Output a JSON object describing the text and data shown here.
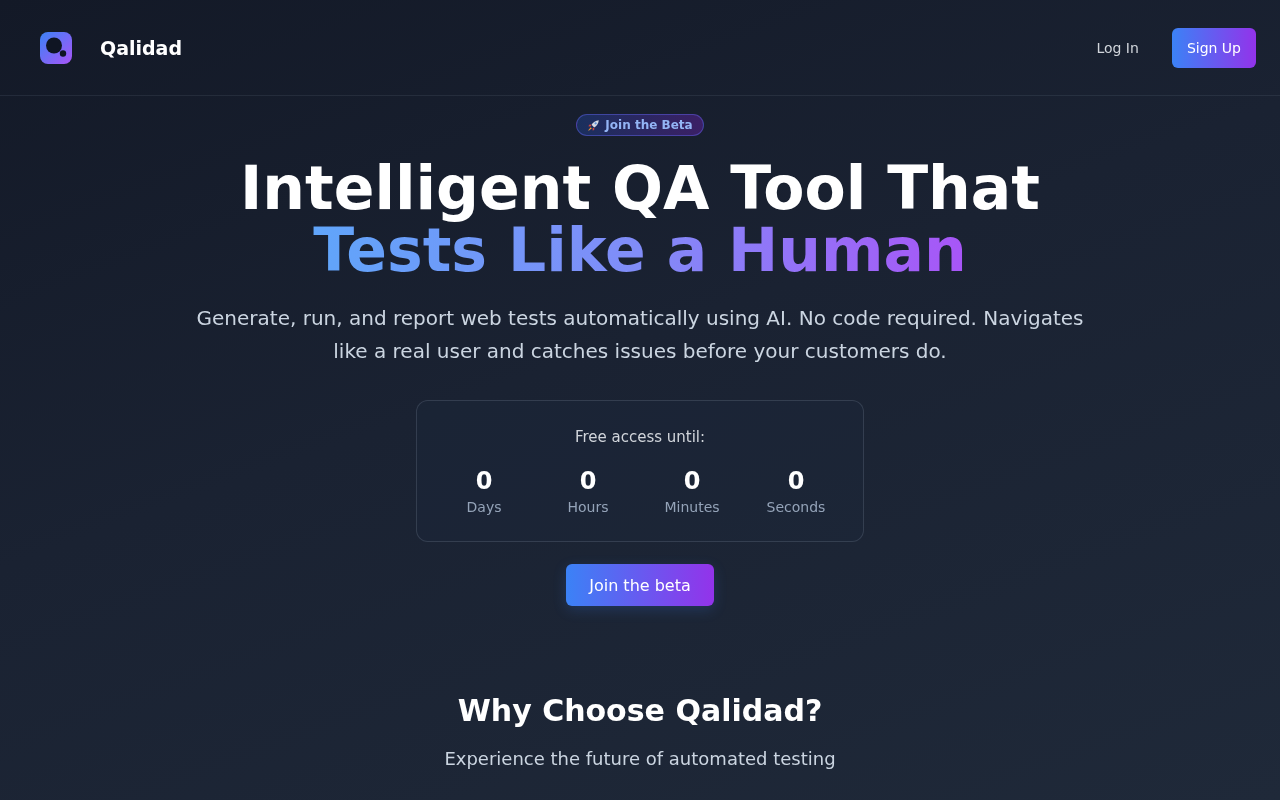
{
  "nav": {
    "brand": "Qalidad",
    "actions": [
      {
        "label": "Log In",
        "kind": "link"
      },
      {
        "label": "Sign Up",
        "kind": "primary"
      }
    ]
  },
  "hero": {
    "badge": "Join the Beta",
    "title": "Intelligent QA Tool That",
    "title_highlight": "Tests Like a Human",
    "description": "Generate, run, and report web tests automatically using AI. No code required. Navigates like a real user and catches issues before your customers do.",
    "countdown": {
      "label": "Free access until:",
      "units": [
        {
          "value": "0",
          "label": "Days"
        },
        {
          "value": "0",
          "label": "Hours"
        },
        {
          "value": "0",
          "label": "Minutes"
        },
        {
          "value": "0",
          "label": "Seconds"
        }
      ]
    },
    "cta": "Join the beta"
  },
  "features": {
    "title": "Why Choose Qalidad?",
    "subtitle": "Experience the future of automated testing"
  }
}
